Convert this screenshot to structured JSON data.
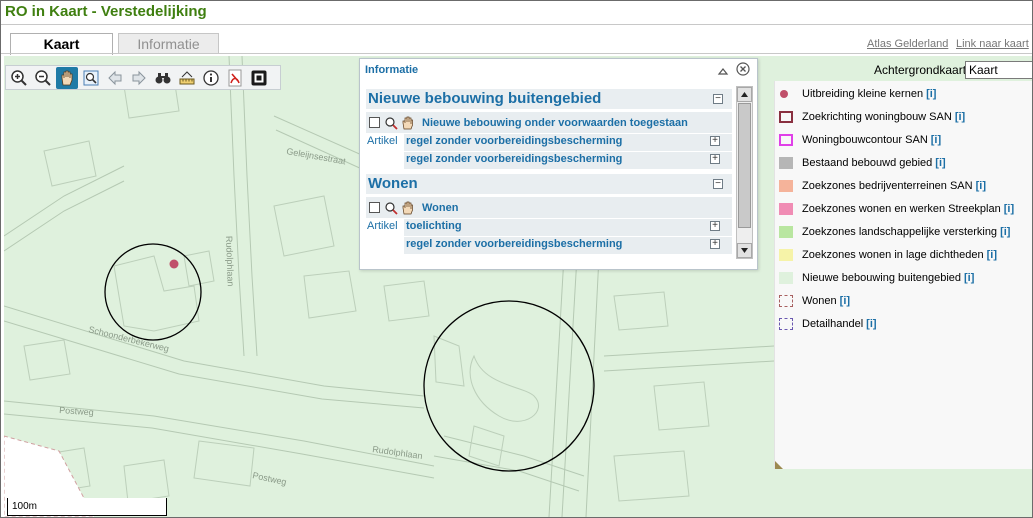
{
  "app": {
    "title": "RO in Kaart - Verstedelijking"
  },
  "tabs": [
    {
      "label": "Kaart",
      "active": true
    },
    {
      "label": "Informatie",
      "active": false
    }
  ],
  "links": {
    "atlas": "Atlas Gelderland",
    "link_kaart": "Link naar kaart"
  },
  "toolbar": {
    "buttons": [
      "zoom-in-icon",
      "zoom-out-icon",
      "pan-hand-icon",
      "zoom-extent-icon",
      "back-arrow-icon",
      "forward-arrow-icon",
      "binoculars-icon",
      "measure-icon",
      "info-icon",
      "pdf-icon",
      "fullscreen-icon"
    ],
    "active": "pan-hand-icon"
  },
  "background": {
    "label": "Achtergrondkaart",
    "selected": "Kaart"
  },
  "legend": {
    "items": [
      {
        "label": "Uitbreiding kleine kernen",
        "info": "[i]",
        "color": "#c0506a",
        "shape": "dot"
      },
      {
        "label": "Zoekrichting woningbouw SAN",
        "info": "[i]",
        "color": "#8a3040",
        "shape": "outline"
      },
      {
        "label": "Woningbouwcontour SAN",
        "info": "[i]",
        "color": "#e040e8",
        "shape": "outline"
      },
      {
        "label": "Bestaand bebouwd gebied",
        "info": "[i]",
        "color": "#b6b6b6",
        "shape": "fill"
      },
      {
        "label": "Zoekzones bedrijventerreinen SAN",
        "info": "[i]",
        "color": "#f5b39a",
        "shape": "fill"
      },
      {
        "label": "Zoekzones wonen en werken Streekplan",
        "info": "[i]",
        "color": "#f08cb4",
        "shape": "fill"
      },
      {
        "label": "Zoekzones landschappelijke versterking",
        "info": "[i]",
        "color": "#b9e6a0",
        "shape": "fill"
      },
      {
        "label": "Zoekzones wonen in lage dichtheden",
        "info": "[i]",
        "color": "#f6f3a8",
        "shape": "fill"
      },
      {
        "label": "Nieuwe bebouwing buitengebied",
        "info": "[i]",
        "color": "#dff1dd",
        "shape": "fill"
      },
      {
        "label": "Wonen",
        "info": "[i]",
        "color": "#a86060",
        "shape": "dashed"
      },
      {
        "label": "Detailhandel",
        "info": "[i]",
        "color": "#6a58b0",
        "shape": "dashed"
      }
    ]
  },
  "popup": {
    "title": "Informatie",
    "sections": [
      {
        "title": "Nieuwe bebouwing buitengebied",
        "item": "Nieuwe bebouwing onder voorwaarden toegestaan",
        "artikel_label": "Artikel",
        "articles": [
          "regel zonder voorbereidingsbescherming",
          "regel zonder voorbereidingsbescherming"
        ]
      },
      {
        "title": "Wonen",
        "item": "Wonen",
        "artikel_label": "Artikel",
        "articles": [
          "toelichting",
          "regel zonder voorbereidingsbescherming"
        ]
      }
    ]
  },
  "map": {
    "streets": [
      "Geleijnsestraat",
      "Rudolphlaan",
      "Schoonderbekerweg",
      "Rudolphlaan",
      "Postweg",
      "Postweg"
    ],
    "scale": "100m"
  },
  "colors": {
    "accent": "#1c6fa6",
    "title_green": "#3f7f10",
    "map_bg": "#dff1dd"
  }
}
